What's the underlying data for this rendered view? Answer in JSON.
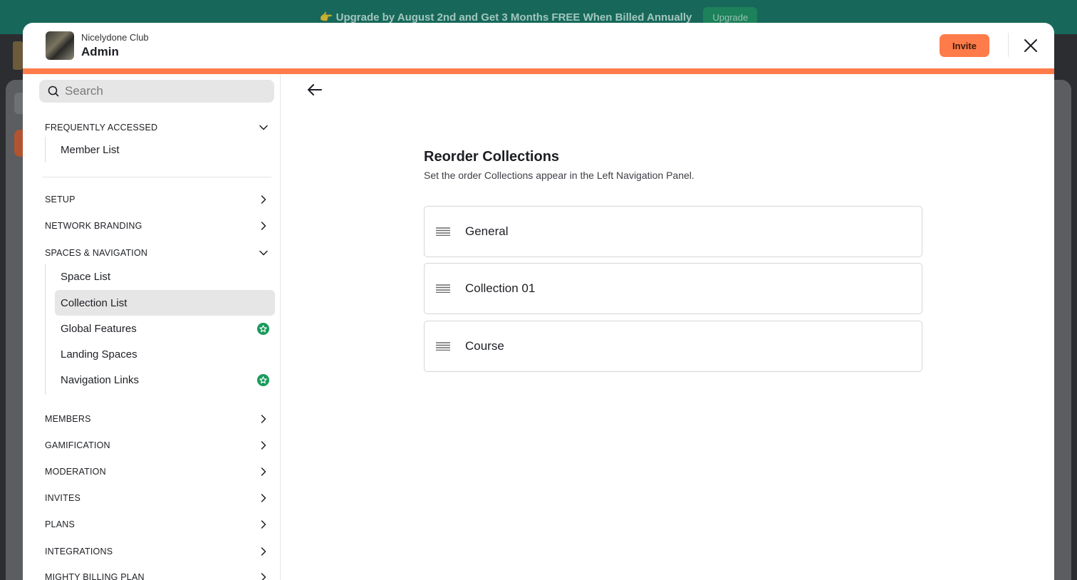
{
  "banner": {
    "text": "👉 Upgrade by August 2nd and Get 3 Months FREE When Billed Annually",
    "button": "Upgrade"
  },
  "header": {
    "network_name": "Nicelydone Club",
    "title": "Admin",
    "invite_label": "Invite"
  },
  "search": {
    "placeholder": "Search"
  },
  "sidebar": {
    "frequently_accessed": {
      "label": "FREQUENTLY ACCESSED",
      "items": [
        {
          "label": "Member List"
        }
      ]
    },
    "sections": [
      {
        "label": "SETUP"
      },
      {
        "label": "NETWORK BRANDING"
      },
      {
        "label": "SPACES & NAVIGATION"
      },
      {
        "label": "MEMBERS"
      },
      {
        "label": "GAMIFICATION"
      },
      {
        "label": "MODERATION"
      },
      {
        "label": "INVITES"
      },
      {
        "label": "PLANS"
      },
      {
        "label": "INTEGRATIONS"
      },
      {
        "label": "MIGHTY BILLING PLAN"
      }
    ],
    "spaces_items": [
      {
        "label": "Space List"
      },
      {
        "label": "Collection List",
        "active": true
      },
      {
        "label": "Global Features",
        "badge": "star-badge-icon"
      },
      {
        "label": "Landing Spaces"
      },
      {
        "label": "Navigation Links",
        "badge": "star-badge-icon"
      }
    ]
  },
  "main": {
    "title": "Reorder Collections",
    "subtitle": "Set the order Collections appear in the Left Navigation Panel.",
    "collections": [
      {
        "label": "General"
      },
      {
        "label": "Collection 01"
      },
      {
        "label": "Course"
      }
    ]
  },
  "colors": {
    "accent": "#ff7b4a",
    "banner": "#17685a",
    "badge": "#1a9a5c"
  }
}
